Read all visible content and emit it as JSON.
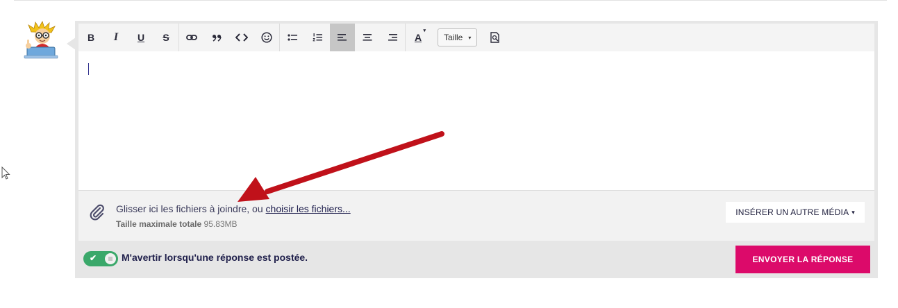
{
  "toolbar": {
    "buttons": [
      {
        "name": "bold-button",
        "label": "B",
        "icon": "bold-icon"
      },
      {
        "name": "italic-button",
        "label": "I",
        "icon": "italic-icon"
      },
      {
        "name": "underline-button",
        "label": "U",
        "icon": "underline-icon"
      },
      {
        "name": "strikethrough-button",
        "label": "S",
        "icon": "strikethrough-icon"
      },
      {
        "name": "link-button",
        "icon": "link-icon"
      },
      {
        "name": "quote-button",
        "icon": "quote-icon"
      },
      {
        "name": "code-button",
        "icon": "code-icon"
      },
      {
        "name": "emoji-button",
        "icon": "smiley-icon"
      },
      {
        "name": "bullet-list-button",
        "icon": "bullet-list-icon"
      },
      {
        "name": "numbered-list-button",
        "icon": "numbered-list-icon"
      },
      {
        "name": "align-left-button",
        "icon": "align-left-icon",
        "active": true
      },
      {
        "name": "align-center-button",
        "icon": "align-center-icon"
      },
      {
        "name": "align-right-button",
        "icon": "align-right-icon"
      },
      {
        "name": "text-color-button",
        "label": "A",
        "icon": "text-color-icon"
      }
    ],
    "size_select": {
      "label": "Taille"
    },
    "preview_icon": "preview-icon"
  },
  "editor": {
    "content": ""
  },
  "attachments": {
    "drop_text": "Glisser ici les fichiers à joindre, ou ",
    "choose_link": "choisir les fichiers...",
    "max_size_label": "Taille maximale totale",
    "max_size_value": "95.83MB",
    "insert_media_label": "INSÉRER UN AUTRE MÉDIA"
  },
  "footer": {
    "notify_label": "M'avertir lorsqu'une réponse est postée.",
    "notify_enabled": true,
    "send_label": "ENVOYER LA RÉPONSE"
  },
  "colors": {
    "accent": "#dc0a6a",
    "toggle_on": "#3aa86a",
    "annotation_arrow": "#c0111a"
  }
}
